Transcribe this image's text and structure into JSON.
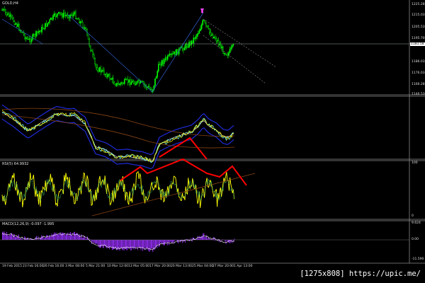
{
  "watermark": "[1275x808] https://upic.me/",
  "panes": {
    "price": {
      "label": "GOLD,H4",
      "ticks": [
        "1225.28",
        "1215.03",
        "1205.53",
        "1195.70",
        "1186.03",
        "1176.03",
        "1166.28",
        "1146.53"
      ],
      "current_price": "1181.58"
    },
    "bands": {
      "label": ""
    },
    "rsi": {
      "label": "RSI(5) 64.9932",
      "ticks": [
        "100",
        "0"
      ]
    },
    "macd": {
      "label": "MACD(12,26,9) -0.097 -1.995",
      "ticks": [
        "9.624",
        "0.00",
        "-11.590"
      ]
    }
  },
  "time_axis": [
    "19 Feb 2015",
    "23 Feb 16:00",
    "26 Feb 16:00",
    "3 Mar 08:00",
    "5 Mar 21:00",
    "10 Mar 12:00",
    "13 Mar 05:00",
    "17 Mar 20:00",
    "20 Mar 13:00",
    "25 Mar 04:00",
    "27 Mar 20:00",
    "1 Apr 13:00"
  ],
  "colors": {
    "background": "#000000",
    "candles": "#00ff00",
    "bands": "#1f2bd8",
    "band_mid": "#ffffff",
    "ma": "#8b4513",
    "trend_lines": "#2f5fd0",
    "rsi": "#ffff00",
    "divergence": "#ff0000",
    "macd_hist": "#9b30ff",
    "marker": "#ff44ff"
  }
}
